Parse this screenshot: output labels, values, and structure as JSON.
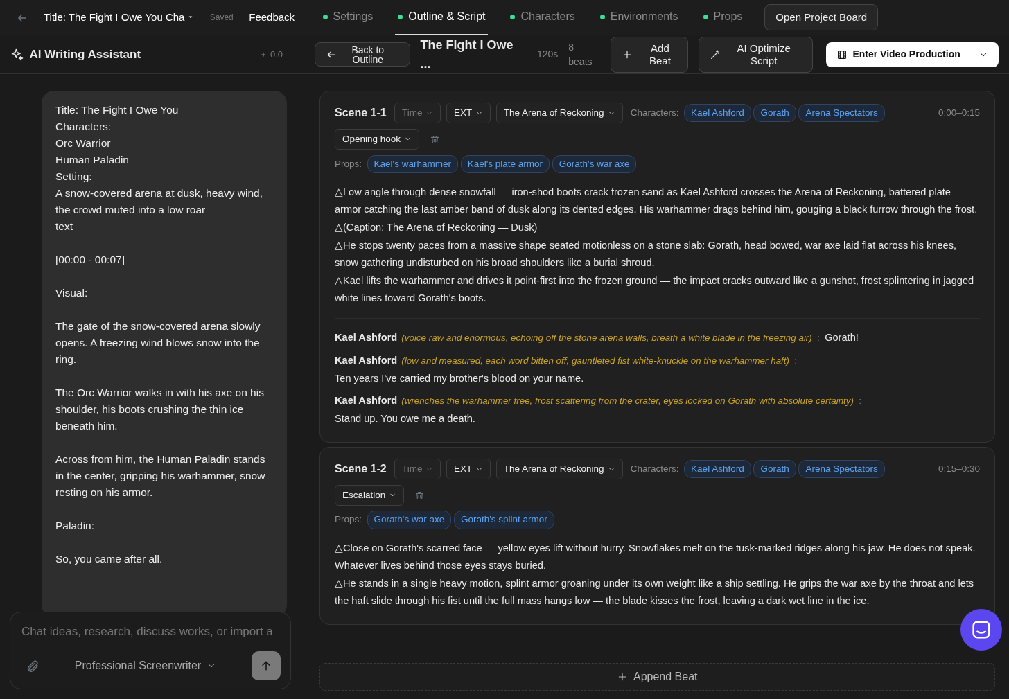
{
  "topbar": {
    "project_title": "Title: The Fight I Owe You Cha",
    "save_status": "Saved",
    "feedback": "Feedback",
    "tabs": [
      {
        "label": "Settings",
        "selected": false
      },
      {
        "label": "Outline & Script",
        "selected": true
      },
      {
        "label": "Characters",
        "selected": false
      },
      {
        "label": "Environments",
        "selected": false
      },
      {
        "label": "Props",
        "selected": false
      }
    ],
    "board_button": "Open Project Board"
  },
  "assistant": {
    "title": "AI Writing Assistant",
    "credits": "0.0",
    "message": [
      [
        "Title: The Fight I Owe You",
        "Characters:",
        "Orc Warrior",
        "Human Paladin",
        "Setting:",
        "A snow-covered arena at dusk, heavy wind, the crowd muted into a low roar",
        "text"
      ],
      [
        "[00:00 - 00:07]"
      ],
      [
        "Visual:"
      ],
      [
        "The gate of the snow-covered arena slowly opens. A freezing wind blows snow into the ring."
      ],
      [
        "The Orc Warrior walks in with his axe on his shoulder, his boots crushing the thin ice beneath him."
      ],
      [
        "Across from him, the Human Paladin stands in the center, gripping his warhammer, snow resting on his armor."
      ],
      [
        "Paladin:"
      ],
      [
        "So, you came after all."
      ]
    ],
    "input": {
      "placeholder": "Chat ideas, research, discuss works, or import a"
    },
    "persona": "Professional Screenwriter"
  },
  "toolbar": {
    "back": "Back to Outline",
    "title": "The Fight I Owe ...",
    "duration": "120s",
    "beats": "8 beats",
    "add_beat": "Add Beat",
    "optimize": "AI Optimize Script",
    "production": "Enter Video Production"
  },
  "scenes": [
    {
      "title": "Scene 1-1",
      "time": "Time",
      "ext": "EXT",
      "location": "The Arena of Reckoning",
      "characters_label": "Characters:",
      "characters": [
        "Kael Ashford",
        "Gorath",
        "Arena Spectators"
      ],
      "timecode": "0:00–0:15",
      "beat": "Opening hook",
      "props_label": "Props:",
      "props": [
        "Kael's warhammer",
        "Kael's plate armor",
        "Gorath's war axe"
      ],
      "actions": [
        "△Low angle through dense snowfall — iron-shod boots crack frozen sand as Kael Ashford crosses the Arena of Reckoning, battered plate armor catching the last amber band of dusk along its dented edges. His warhammer drags behind him, gouging a black furrow through the frost.",
        "△(Caption: The Arena of Reckoning — Dusk)",
        "△He stops twenty paces from a massive shape seated motionless on a stone slab: Gorath, head bowed, war axe laid flat across his knees, snow gathering undisturbed on his broad shoulders like a burial shroud.",
        "△Kael lifts the warhammer and drives it point-first into the frozen ground — the impact cracks outward like a gunshot, frost splintering in jagged white lines toward Gorath's boots."
      ],
      "dialogues": [
        {
          "speaker": "Kael Ashford",
          "direction": "(voice raw and enormous, echoing off the stone arena walls, breath a white blade in the freezing air)",
          "separator": ":",
          "line": "Gorath!"
        },
        {
          "speaker": "Kael Ashford",
          "direction": "(low and measured, each word bitten off, gauntleted fist white-knuckle on the warhammer haft)",
          "separator": ":",
          "line": "Ten years I've carried my brother's blood on your name."
        },
        {
          "speaker": "Kael Ashford",
          "direction": "(wrenches the warhammer free, frost scattering from the crater, eyes locked on Gorath with absolute certainty)",
          "separator": ":",
          "line": "Stand up. You owe me a death."
        }
      ]
    },
    {
      "title": "Scene 1-2",
      "time": "Time",
      "ext": "EXT",
      "location": "The Arena of Reckoning",
      "characters_label": "Characters:",
      "characters": [
        "Kael Ashford",
        "Gorath",
        "Arena Spectators"
      ],
      "timecode": "0:15–0:30",
      "beat": "Escalation",
      "props_label": "Props:",
      "props": [
        "Gorath's war axe",
        "Gorath's splint armor"
      ],
      "actions": [
        "△Close on Gorath's scarred face — yellow eyes lift without hurry. Snowflakes melt on the tusk-marked ridges along his jaw. He does not speak. Whatever lives behind those eyes stays buried.",
        "△He stands in a single heavy motion, splint armor groaning under its own weight like a ship settling. He grips the war axe by the throat and lets the haft slide through his fist until the full mass hangs low — the blade kisses the frost, leaving a dark wet line in the ice."
      ]
    }
  ],
  "append_beat": "Append Beat"
}
